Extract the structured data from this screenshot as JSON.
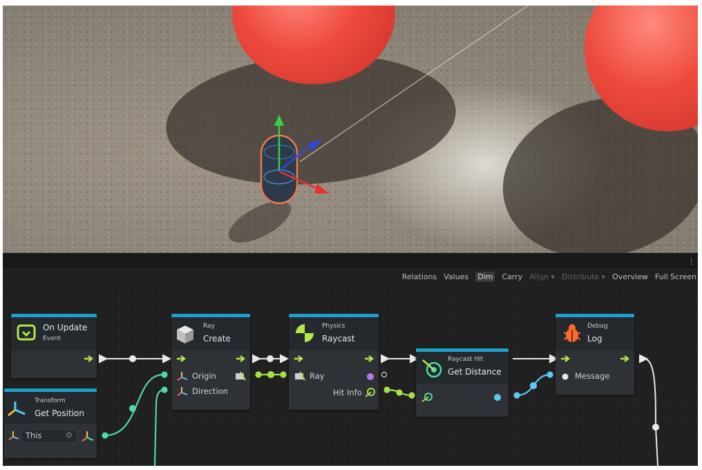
{
  "toolbar": {
    "items": [
      {
        "label": "Relations",
        "state": "normal"
      },
      {
        "label": "Values",
        "state": "normal"
      },
      {
        "label": "Dim",
        "state": "active"
      },
      {
        "label": "Carry",
        "state": "normal"
      },
      {
        "label": "Align ▾",
        "state": "dim"
      },
      {
        "label": "Distribute ▾",
        "state": "dim"
      },
      {
        "label": "Overview",
        "state": "normal"
      },
      {
        "label": "Full Screen",
        "state": "normal"
      }
    ],
    "more_glyph": "⋮"
  },
  "nodes": {
    "on_update": {
      "kind": "On Update",
      "title": "Event"
    },
    "get_position": {
      "kind": "Transform",
      "title": "Get Position",
      "field_value": "This",
      "field_glyph": "⊙"
    },
    "ray_create": {
      "kind": "Ray",
      "title": "Create",
      "port_origin": "Origin",
      "port_direction": "Direction"
    },
    "raycast": {
      "kind": "Physics",
      "title": "Raycast",
      "port_ray": "Ray",
      "port_hitinfo": "Hit Info"
    },
    "get_distance": {
      "kind": "Raycast Hit",
      "title": "Get Distance"
    },
    "debug_log": {
      "kind": "Debug",
      "title": "Log",
      "port_message": "Message"
    }
  },
  "colors": {
    "header_stripe": "#1fa0c8",
    "control_flow": "#e8e8e8",
    "vector3": "#4fd8a8",
    "ray": "#a6e04b",
    "float": "#5cc8f5",
    "flow_arrow": "#b6e84a",
    "event_icon": "#b6e84a",
    "debug_icon": "#ff6a2a"
  }
}
